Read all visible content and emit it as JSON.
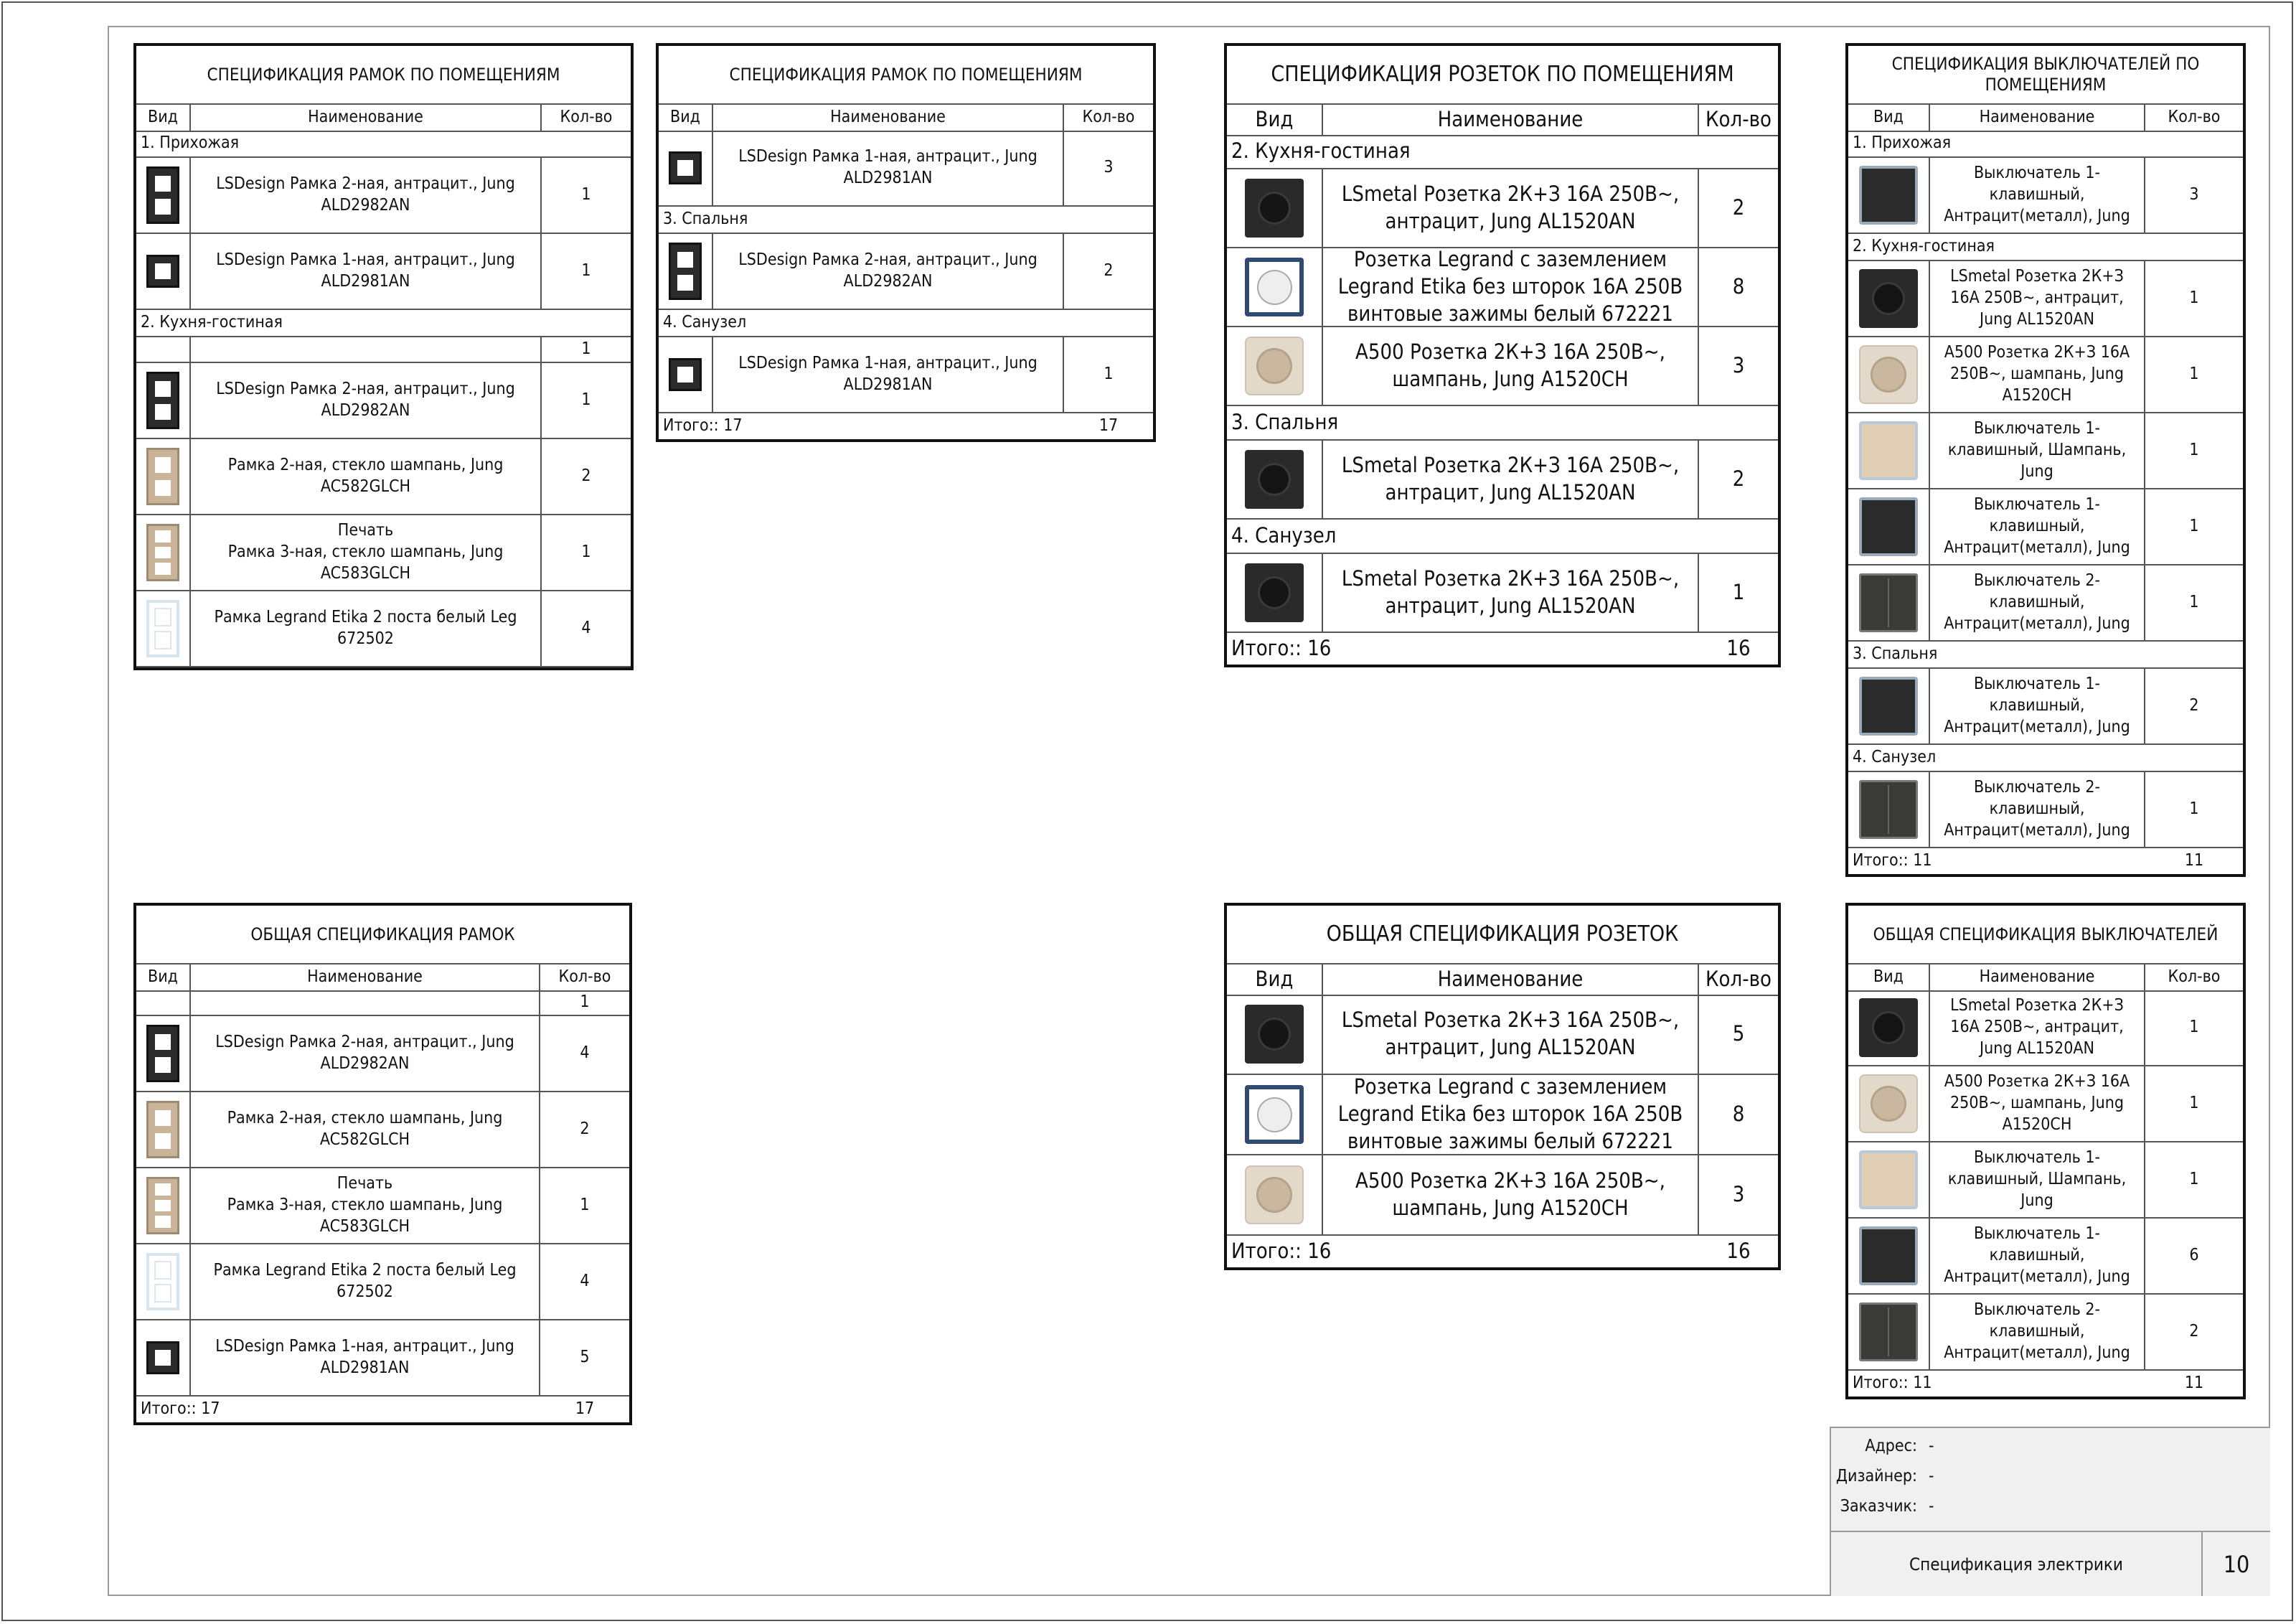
{
  "tables": {
    "frames_rooms_1": {
      "title": "СПЕЦИФИКАЦИЯ РАМОК ПО ПОМЕЩЕНИЯМ",
      "headers": [
        "Вид",
        "Наименование",
        "Кол-во"
      ],
      "rows": [
        {
          "group": "1. Прихожая"
        },
        {
          "icon": "frame-2-anthracite",
          "name": "LSDesign Рамка 2-ная, антрацит., Jung ALD2982AN",
          "qty": "1"
        },
        {
          "icon": "frame-1-anthracite",
          "name": "LSDesign Рамка 1-ная, антрацит., Jung ALD2981AN",
          "qty": "1"
        },
        {
          "group": "2. Кухня-гостиная"
        },
        {
          "icon": "",
          "name": "",
          "qty": "1"
        },
        {
          "icon": "frame-2-anthracite",
          "name": "LSDesign Рамка 2-ная, антрацит., Jung ALD2982AN",
          "qty": "1"
        },
        {
          "icon": "frame-2-champagne",
          "name": "Рамка 2-ная, стекло шампань, Jung AC582GLCH",
          "qty": "2"
        },
        {
          "icon": "frame-3-champagne",
          "name": "Печать\nРамка 3-ная, стекло шампань, Jung AC583GLCH",
          "qty": "1"
        },
        {
          "icon": "frame-2-white",
          "name": "Рамка Legrand Etika 2 поста белый Leg 672502",
          "qty": "4"
        }
      ]
    },
    "frames_rooms_2": {
      "title": "СПЕЦИФИКАЦИЯ РАМОК ПО ПОМЕЩЕНИЯМ",
      "headers": [
        "Вид",
        "Наименование",
        "Кол-во"
      ],
      "rows": [
        {
          "icon": "frame-1-anthracite",
          "name": "LSDesign Рамка 1-ная, антрацит., Jung ALD2981AN",
          "qty": "3"
        },
        {
          "group": "3. Спальня"
        },
        {
          "icon": "frame-2-anthracite",
          "name": "LSDesign Рамка 2-ная, антрацит., Jung ALD2982AN",
          "qty": "2"
        },
        {
          "group": "4. Санузел"
        },
        {
          "icon": "frame-1-anthracite",
          "name": "LSDesign Рамка 1-ная, антрацит., Jung ALD2981AN",
          "qty": "1"
        }
      ],
      "total_label": "Итого:: 17",
      "total_value": "17"
    },
    "sockets_rooms": {
      "title": "СПЕЦИФИКАЦИЯ РОЗЕТОК ПО ПОМЕЩЕНИЯМ",
      "headers": [
        "Вид",
        "Наименование",
        "Кол-во"
      ],
      "rows": [
        {
          "group": "2. Кухня-гостиная"
        },
        {
          "icon": "socket-anthracite",
          "name": "LSmetal Розетка 2К+З 16А 250В~, антрацит, Jung AL1520AN",
          "qty": "2"
        },
        {
          "icon": "socket-legrand-white",
          "name": "Розетка Legrand с заземлением Legrand Etika без шторок 16А 250В винтовые зажимы белый 672221",
          "qty": "8"
        },
        {
          "icon": "socket-champagne",
          "name": "A500 Розетка 2К+З 16А 250В~, шампань, Jung A1520CH",
          "qty": "3"
        },
        {
          "group": "3. Спальня"
        },
        {
          "icon": "socket-anthracite",
          "name": "LSmetal Розетка 2К+З 16А 250В~, антрацит, Jung AL1520AN",
          "qty": "2"
        },
        {
          "group": "4. Санузел"
        },
        {
          "icon": "socket-anthracite",
          "name": "LSmetal Розетка 2К+З 16А 250В~, антрацит, Jung AL1520AN",
          "qty": "1"
        }
      ],
      "total_label": "Итого:: 16",
      "total_value": "16"
    },
    "switches_rooms": {
      "title": "СПЕЦИФИКАЦИЯ ВЫКЛЮЧАТЕЛЕЙ ПО ПОМЕЩЕНИЯМ",
      "headers": [
        "Вид",
        "Наименование",
        "Кол-во"
      ],
      "rows": [
        {
          "group": "1. Прихожая"
        },
        {
          "icon": "switch-1-anthracite",
          "name": "Выключатель 1-клавишный, Антрацит(металл), Jung",
          "qty": "3"
        },
        {
          "group": "2. Кухня-гостиная"
        },
        {
          "icon": "socket-anthracite",
          "name": "LSmetal Розетка 2К+З 16А 250В~, антрацит, Jung AL1520AN",
          "qty": "1"
        },
        {
          "icon": "socket-champagne",
          "name": "A500 Розетка 2К+З 16А 250В~, шампань, Jung A1520CH",
          "qty": "1"
        },
        {
          "icon": "switch-1-champagne",
          "name": "Выключатель 1-клавишный, Шампань, Jung",
          "qty": "1"
        },
        {
          "icon": "switch-1-anthracite",
          "name": "Выключатель 1-клавишный, Антрацит(металл), Jung",
          "qty": "1"
        },
        {
          "icon": "switch-2-anthracite",
          "name": "Выключатель 2-клавишный, Антрацит(металл), Jung",
          "qty": "1"
        },
        {
          "group": "3. Спальня"
        },
        {
          "icon": "switch-1-anthracite",
          "name": "Выключатель 1-клавишный, Антрацит(металл), Jung",
          "qty": "2"
        },
        {
          "group": "4. Санузел"
        },
        {
          "icon": "switch-2-anthracite",
          "name": "Выключатель 2-клавишный, Антрацит(металл), Jung",
          "qty": "1"
        }
      ],
      "total_label": "Итого:: 11",
      "total_value": "11"
    },
    "frames_total": {
      "title": "ОБЩАЯ СПЕЦИФИКАЦИЯ РАМОК",
      "headers": [
        "Вид",
        "Наименование",
        "Кол-во"
      ],
      "rows": [
        {
          "icon": "",
          "name": "",
          "qty": "1"
        },
        {
          "icon": "frame-2-anthracite",
          "name": "LSDesign Рамка 2-ная, антрацит., Jung ALD2982AN",
          "qty": "4"
        },
        {
          "icon": "frame-2-champagne",
          "name": "Рамка 2-ная, стекло шампань, Jung AC582GLCH",
          "qty": "2"
        },
        {
          "icon": "frame-3-champagne",
          "name": "Печать\nРамка 3-ная, стекло шампань, Jung AC583GLCH",
          "qty": "1"
        },
        {
          "icon": "frame-2-white",
          "name": "Рамка Legrand Etika 2 поста белый Leg 672502",
          "qty": "4"
        },
        {
          "icon": "frame-1-anthracite",
          "name": "LSDesign Рамка 1-ная, антрацит., Jung ALD2981AN",
          "qty": "5"
        }
      ],
      "total_label": "Итого:: 17",
      "total_value": "17"
    },
    "sockets_total": {
      "title": "ОБЩАЯ СПЕЦИФИКАЦИЯ РОЗЕТОК",
      "headers": [
        "Вид",
        "Наименование",
        "Кол-во"
      ],
      "rows": [
        {
          "icon": "socket-anthracite",
          "name": "LSmetal Розетка 2К+З 16А 250В~, антрацит, Jung AL1520AN",
          "qty": "5"
        },
        {
          "icon": "socket-legrand-white",
          "name": "Розетка Legrand с заземлением Legrand Etika без шторок 16А 250В винтовые зажимы белый 672221",
          "qty": "8"
        },
        {
          "icon": "socket-champagne",
          "name": "A500 Розетка 2К+З 16А 250В~, шампань, Jung A1520CH",
          "qty": "3"
        }
      ],
      "total_label": "Итого:: 16",
      "total_value": "16"
    },
    "switches_total": {
      "title": "ОБЩАЯ СПЕЦИФИКАЦИЯ ВЫКЛЮЧАТЕЛЕЙ",
      "headers": [
        "Вид",
        "Наименование",
        "Кол-во"
      ],
      "rows": [
        {
          "icon": "socket-anthracite",
          "name": "LSmetal Розетка 2К+З 16А 250В~, антрацит, Jung AL1520AN",
          "qty": "1"
        },
        {
          "icon": "socket-champagne",
          "name": "A500 Розетка 2К+З 16А 250В~, шампань, Jung A1520CH",
          "qty": "1"
        },
        {
          "icon": "switch-1-champagne",
          "name": "Выключатель 1-клавишный, Шампань, Jung",
          "qty": "1"
        },
        {
          "icon": "switch-1-anthracite",
          "name": "Выключатель 1-клавишный, Антрацит(металл), Jung",
          "qty": "6"
        },
        {
          "icon": "switch-2-anthracite",
          "name": "Выключатель 2-клавишный, Антрацит(металл), Jung",
          "qty": "2"
        }
      ],
      "total_label": "Итого:: 11",
      "total_value": "11"
    }
  },
  "title_block": {
    "address_label": "Адрес:",
    "address_value": "-",
    "designer_label": "Дизайнер:",
    "designer_value": "-",
    "customer_label": "Заказчик:",
    "customer_value": "-",
    "sheet_name": "Спецификация электрики",
    "sheet_number": "10"
  }
}
